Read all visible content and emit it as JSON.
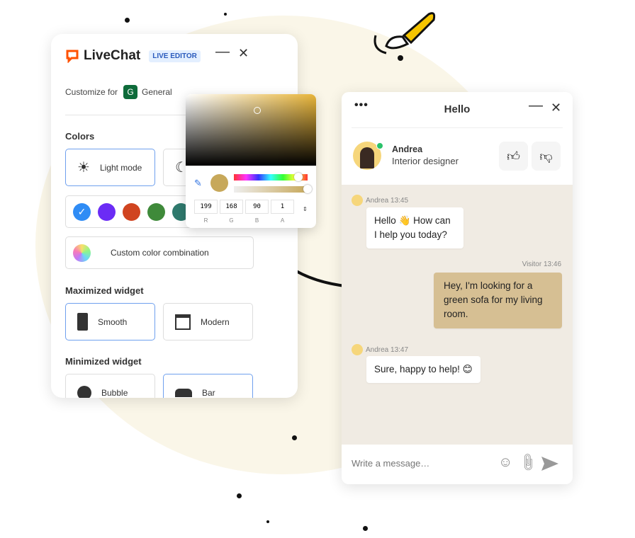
{
  "editor": {
    "brand": "LiveChat",
    "badge": "LIVE EDITOR",
    "customize_label": "Customize for",
    "group_initial": "G",
    "group_name": "General",
    "colors_title": "Colors",
    "light_mode": "Light mode",
    "custom_color": "Custom color combination",
    "swatches": [
      "#2f8cf5",
      "#6b2cf5",
      "#d04420",
      "#3f8a3a",
      "#2f7a6e"
    ],
    "selected_swatch": 0,
    "maximized_title": "Maximized widget",
    "smooth": "Smooth",
    "modern": "Modern",
    "minimized_title": "Minimized widget",
    "bubble": "Bubble",
    "bar": "Bar"
  },
  "picker": {
    "r": "199",
    "g": "168",
    "b": "90",
    "a": "1",
    "labels": [
      "R",
      "G",
      "B",
      "A"
    ],
    "color": "#c7a85a"
  },
  "chat": {
    "title": "Hello",
    "agent_name": "Andrea",
    "agent_role": "Interior designer",
    "messages": [
      {
        "meta": "Andrea 13:45",
        "text": "Hello 👋 How can I help you today?"
      },
      {
        "meta": "Visitor 13:46",
        "text": "Hey, I'm looking for a green sofa for my living room."
      },
      {
        "meta": "Andrea 13:47",
        "text": "Sure, happy to help! 😊"
      }
    ],
    "placeholder": "Write a message…",
    "visitor_bubble_color": "#d6bf93"
  }
}
